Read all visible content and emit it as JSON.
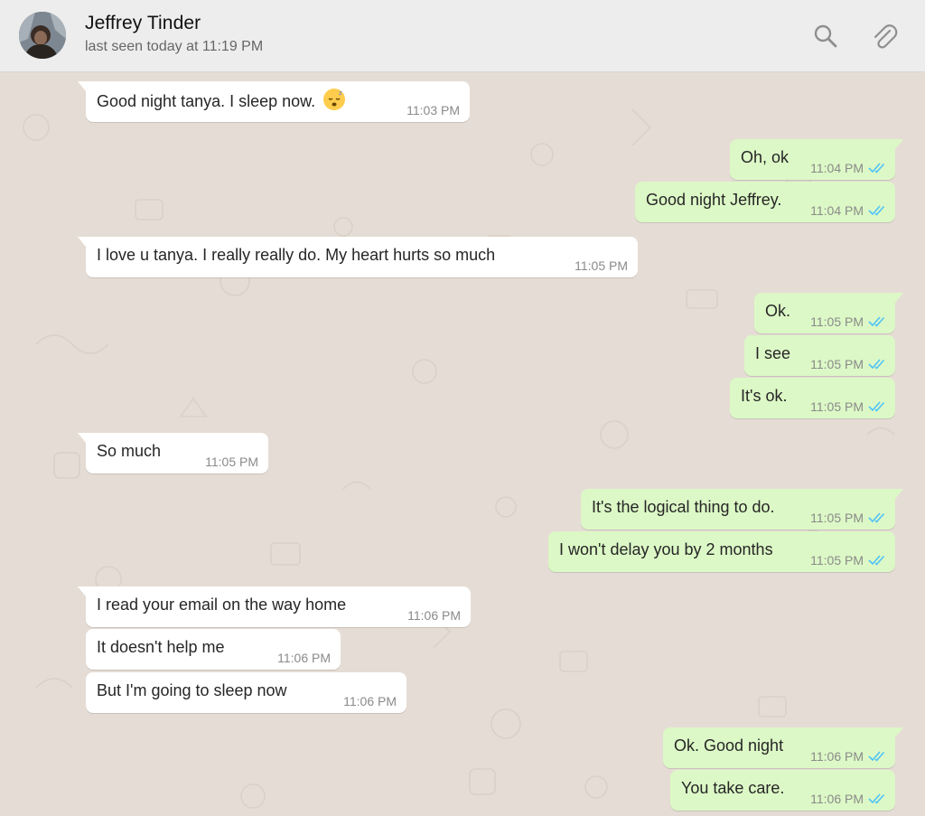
{
  "header": {
    "contact_name": "Jeffrey Tinder",
    "status": "last seen today at 11:19 PM",
    "icons": [
      "search-icon",
      "paperclip-icon"
    ]
  },
  "colors": {
    "incoming_bubble": "#ffffff",
    "outgoing_bubble": "#dcf8c6",
    "read_ticks": "#4fc3f7",
    "chat_background": "#e5ddd5",
    "header_background": "#ededed"
  },
  "messages": [
    {
      "direction": "incoming",
      "text": "Good night tanya. I sleep now.",
      "time": "11:03 PM",
      "emoji": "sleeping-face-emoji"
    },
    {
      "direction": "outgoing",
      "text": "Oh, ok",
      "time": "11:04 PM",
      "status": "read"
    },
    {
      "direction": "outgoing",
      "text": "Good night Jeffrey.",
      "time": "11:04 PM",
      "status": "read"
    },
    {
      "direction": "incoming",
      "text": "I love u tanya.  I really really do.  My heart hurts so much",
      "time": "11:05 PM"
    },
    {
      "direction": "outgoing",
      "text": "Ok.",
      "time": "11:05 PM",
      "status": "read"
    },
    {
      "direction": "outgoing",
      "text": "I see",
      "time": "11:05 PM",
      "status": "read"
    },
    {
      "direction": "outgoing",
      "text": "It's ok.",
      "time": "11:05 PM",
      "status": "read"
    },
    {
      "direction": "incoming",
      "text": "So much",
      "time": "11:05 PM"
    },
    {
      "direction": "outgoing",
      "text": "It's the logical thing to do.",
      "time": "11:05 PM",
      "status": "read"
    },
    {
      "direction": "outgoing",
      "text": "I won't delay you by 2 months",
      "time": "11:05 PM",
      "status": "read"
    },
    {
      "direction": "incoming",
      "text": "I read your email on the way home",
      "time": "11:06 PM"
    },
    {
      "direction": "incoming",
      "text": "It doesn't help me",
      "time": "11:06 PM"
    },
    {
      "direction": "incoming",
      "text": "But I'm going to sleep now",
      "time": "11:06 PM"
    },
    {
      "direction": "outgoing",
      "text": "Ok. Good night",
      "time": "11:06 PM",
      "status": "read"
    },
    {
      "direction": "outgoing",
      "text": "You take care.",
      "time": "11:06 PM",
      "status": "read"
    }
  ]
}
